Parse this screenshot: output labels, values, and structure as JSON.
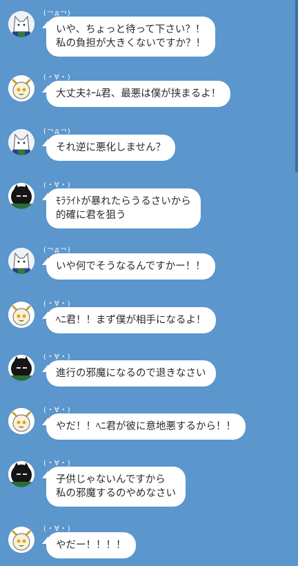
{
  "messages": [
    {
      "name": "(￢д￢)",
      "avatar": "white-cat-avatar",
      "text": "いや、ちょっと待って下さい？！\n私の負担が大きくないですか？！"
    },
    {
      "name": "(・∀・)",
      "avatar": "yellow-cat-avatar",
      "text": "大丈夫ﾈｰﾑ君、最悪は僕が挟まるよ！"
    },
    {
      "name": "(￢д￢)",
      "avatar": "white-cat-avatar",
      "text": "それ逆に悪化しません？"
    },
    {
      "name": "(・∀・)",
      "avatar": "black-cat-avatar",
      "text": "ﾓﾗﾗｲﾄが暴れたらうるさいから\n的確に君を狙う"
    },
    {
      "name": "(￢д￢)",
      "avatar": "white-cat-avatar",
      "text": "いや何でそうなるんですかー！！"
    },
    {
      "name": "(・∀・)",
      "avatar": "yellow-cat-avatar",
      "text": "ﾍﾆ君！！まず僕が相手になるよ！"
    },
    {
      "name": "(・∀・)",
      "avatar": "black-cat-avatar",
      "text": "進行の邪魔になるので退きなさい"
    },
    {
      "name": "(・∀・)",
      "avatar": "yellow-cat-avatar",
      "text": "やだ！！ﾍﾆ君が彼に意地悪するから！！"
    },
    {
      "name": "(・∀・)",
      "avatar": "black-cat-avatar",
      "text": "子供じゃないんですから\n私の邪魔するのやめなさい"
    },
    {
      "name": "(・∀・)",
      "avatar": "yellow-cat-avatar",
      "text": "やだー！！！！"
    }
  ]
}
